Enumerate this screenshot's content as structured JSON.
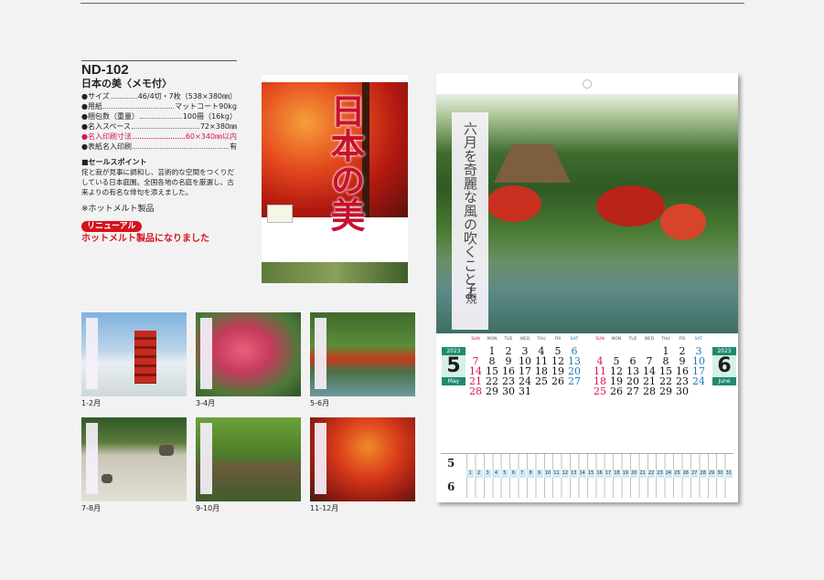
{
  "product": {
    "code": "ND-102",
    "title": "日本の美〈メモ付〉",
    "specs": [
      {
        "label": "●サイズ",
        "value": "46/4切・7枚（538×380㎜）",
        "highlight": false
      },
      {
        "label": "●用紙",
        "value": "マットコート90kg",
        "highlight": false
      },
      {
        "label": "●梱包数（重量）",
        "value": "100冊（16kg）",
        "highlight": false
      },
      {
        "label": "●名入スペース",
        "value": "72×380㎜",
        "highlight": false
      },
      {
        "label": "●名入印刷寸法",
        "value": "60×340㎜以内",
        "highlight": true
      },
      {
        "label": "●表紙名入印刷",
        "value": "有",
        "highlight": false
      }
    ],
    "sales_heading": "■セールスポイント",
    "sales_text": "侘と寂が見事に調和し、芸術的な空間をつくりだしている日本庭園。全国各地の名庭を厳選し、古来よりの有名な俳句を添えました。",
    "hotmelt": "※ホットメルト製品",
    "badge": "リニューアル",
    "renewal_text": "ホットメルト製品になりました"
  },
  "cover": {
    "title": "日本の美"
  },
  "thumbnails": [
    {
      "label": "1-2月"
    },
    {
      "label": "3-4月"
    },
    {
      "label": "5-6月"
    },
    {
      "label": "7-8月"
    },
    {
      "label": "9-10月"
    },
    {
      "label": "11-12月"
    }
  ],
  "calendar": {
    "poem": "六月を奇麗な風の吹くことよ",
    "signature": "子規",
    "day_headers": [
      "SUN",
      "MON",
      "TUE",
      "WED",
      "THU",
      "FRI",
      "SAT"
    ],
    "months": [
      {
        "year": "2023",
        "number": "5",
        "en": "May",
        "days": [
          "",
          "1",
          "2",
          "3",
          "4",
          "5",
          "6",
          "7",
          "8",
          "9",
          "10",
          "11",
          "12",
          "13",
          "14",
          "15",
          "16",
          "17",
          "18",
          "19",
          "20",
          "21",
          "22",
          "23",
          "24",
          "25",
          "26",
          "27",
          "28",
          "29",
          "30",
          "31",
          "",
          "",
          ""
        ]
      },
      {
        "year": "2023",
        "number": "6",
        "en": "June",
        "days": [
          "",
          "",
          "",
          "",
          "1",
          "2",
          "3",
          "4",
          "5",
          "6",
          "7",
          "8",
          "9",
          "10",
          "11",
          "12",
          "13",
          "14",
          "15",
          "16",
          "17",
          "18",
          "19",
          "20",
          "21",
          "22",
          "23",
          "24",
          "25",
          "26",
          "27",
          "28",
          "29",
          "30",
          ""
        ]
      }
    ],
    "memo": {
      "months": [
        "5",
        "6"
      ],
      "days": [
        "1",
        "2",
        "3",
        "4",
        "5",
        "6",
        "7",
        "8",
        "9",
        "10",
        "11",
        "12",
        "13",
        "14",
        "15",
        "16",
        "17",
        "18",
        "19",
        "20",
        "21",
        "22",
        "23",
        "24",
        "25",
        "26",
        "27",
        "28",
        "29",
        "30",
        "31"
      ]
    }
  }
}
